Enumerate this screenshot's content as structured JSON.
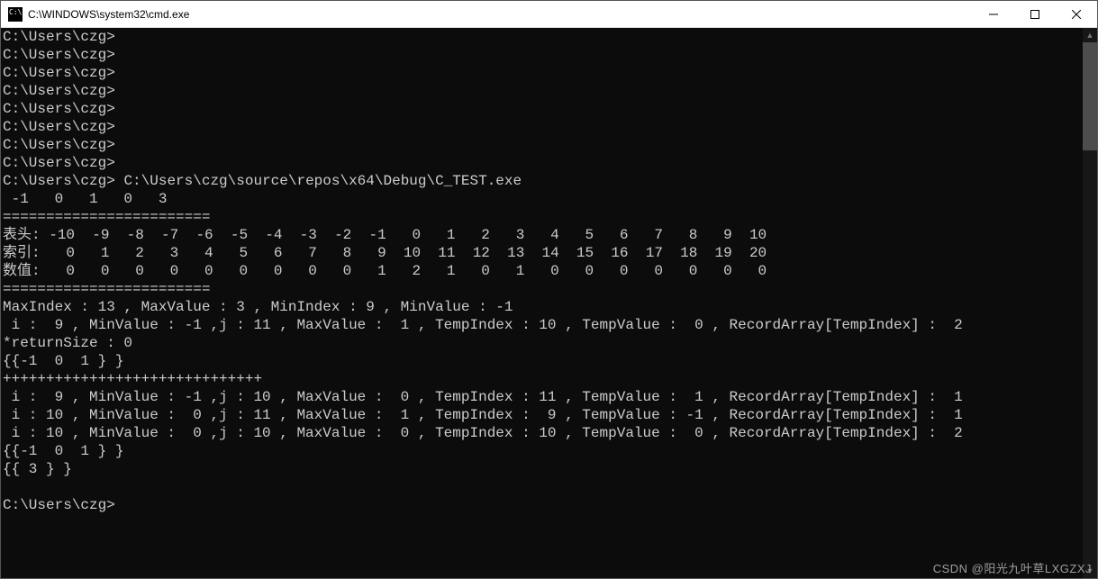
{
  "window": {
    "title": "C:\\WINDOWS\\system32\\cmd.exe"
  },
  "prompt": "C:\\Users\\czg>",
  "command": "C:\\Users\\czg\\source\\repos\\x64\\Debug\\C_TEST.exe",
  "output": {
    "input_row": " -1   0   1   0   3",
    "sep_eq": "========================",
    "table_header_label": "表头:",
    "table_index_label": "索引:",
    "table_value_label": "数值:",
    "table_header": " -10  -9  -8  -7  -6  -5  -4  -3  -2  -1   0   1   2   3   4   5   6   7   8   9  10",
    "table_index": "   0   1   2   3   4   5   6   7   8   9  10  11  12  13  14  15  16  17  18  19  20",
    "table_value": "   0   0   0   0   0   0   0   0   0   1   2   1   0   1   0   0   0   0   0   0   0",
    "summary": "MaxIndex : 13 , MaxValue : 3 , MinIndex : 9 , MinValue : -1",
    "line1": " i :  9 , MinValue : -1 ,j : 11 , MaxValue :  1 , TempIndex : 10 , TempValue :  0 , RecordArray[TempIndex] :  2",
    "return": "*returnSize : 0",
    "set1": "{{-1  0  1 } }",
    "plus": "++++++++++++++++++++++++++++++",
    "line2": " i :  9 , MinValue : -1 ,j : 10 , MaxValue :  0 , TempIndex : 11 , TempValue :  1 , RecordArray[TempIndex] :  1",
    "line3": " i : 10 , MinValue :  0 ,j : 11 , MaxValue :  1 , TempIndex :  9 , TempValue : -1 , RecordArray[TempIndex] :  1",
    "line4": " i : 10 , MinValue :  0 ,j : 10 , MaxValue :  0 , TempIndex : 10 , TempValue :  0 , RecordArray[TempIndex] :  2",
    "set2": "{{-1  0  1 } }",
    "set3": "{{ 3 } }"
  },
  "watermark": "CSDN @阳光九叶草LXGZXJ"
}
